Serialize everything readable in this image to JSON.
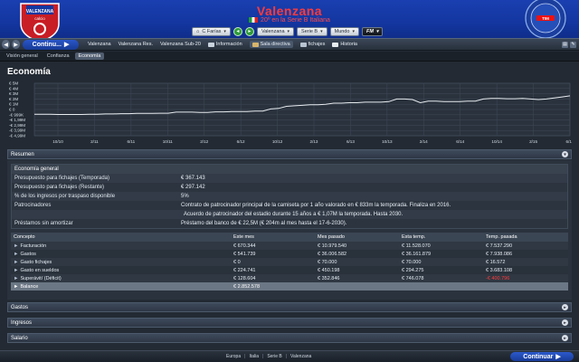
{
  "header": {
    "club_name": "Valenzana",
    "club_subtitle": "20º en la Serie B Italiana",
    "crest_text_1": "VALENZANA",
    "crest_text_2": "calcio",
    "controls": {
      "manager": "C Farías",
      "club": "Valenzana",
      "league": "Serie B",
      "world": "Mundo",
      "fm": "FM"
    }
  },
  "navbar": {
    "continue_label": "Continu...",
    "links": [
      "Valenzana",
      "Valenzana Res.",
      "Valenzana Sub-20",
      "Información",
      "Sala directiva",
      "fichajes",
      "Historia"
    ]
  },
  "subtabs": [
    "Visión general",
    "Confianza",
    "Economía"
  ],
  "page_title": "Economía",
  "chart_data": {
    "type": "line",
    "ylabels": [
      "€ 5M",
      "€ 4M",
      "€ 3M",
      "€ 2M",
      "€ 1M",
      "€ 0",
      "-€ 999K",
      "-€ 1,99M",
      "-€ 2,99M",
      "-€ 3,99M",
      "-€ 4,99M"
    ],
    "yvalues": [
      5,
      4,
      3,
      2,
      1,
      0,
      -1,
      -2,
      -3,
      -4,
      -5
    ],
    "xlabels": [
      "10/10",
      "2/11",
      "6/11",
      "10/11",
      "2/12",
      "6/12",
      "10/12",
      "2/13",
      "6/13",
      "10/13",
      "2/14",
      "6/14",
      "10/14",
      "2/15",
      "6/15"
    ],
    "ylim": [
      -5,
      5
    ],
    "series": [
      {
        "values": [
          -0.9,
          -0.9,
          -0.9,
          -0.95,
          -0.95,
          -0.95,
          -0.95,
          -0.9,
          -0.9,
          -0.85,
          -0.85,
          -0.8,
          -0.8,
          -0.75,
          -0.75,
          -0.75,
          -0.7,
          -0.7,
          -0.5,
          -0.5,
          -0.5,
          -0.55,
          -0.55,
          -0.45,
          -0.45,
          -0.4,
          -0.4,
          -0.4,
          -0.3,
          -0.3,
          0.1,
          0.2,
          0.6,
          0.7,
          0.8,
          0.9,
          0.9,
          1.0,
          1.2,
          1.2,
          1.3,
          1.3,
          1.4,
          1.4,
          1.4,
          1.5,
          2.0,
          2.0,
          1.9,
          1.3,
          1.6,
          1.6,
          1.5,
          1.5,
          1.5,
          1.6,
          1.6,
          2.0,
          2.1,
          2.1,
          2.05,
          2.05,
          2.1,
          2.0,
          1.9,
          2.0,
          2.2,
          2.4,
          2.6
        ]
      }
    ],
    "grid": true,
    "line_color": "#e8ecf0"
  },
  "resumen": {
    "header": "Resumen",
    "general_title": "Economía general",
    "general_rows": [
      {
        "label": "Presupuesto para fichajes (Temporada)",
        "value": "€ 367.143"
      },
      {
        "label": "Presupuesto para fichajes (Restante)",
        "value": "€ 297.142"
      },
      {
        "label": "% de los ingresos por traspaso disponible",
        "value": "5%"
      },
      {
        "label": "Patrocinadores",
        "value": "Contrato de patrocinador principal de la camiseta por 1 año valorado en € 833m la temporada. Finaliza en 2016."
      },
      {
        "label": "",
        "value": "Acuerdo de patrocinador del estadio durante 15 años a € 1,07M la temporada. Hasta 2030."
      },
      {
        "label": "Préstamos sin amortizar",
        "value": "Préstamo del banco de € 22,5M (€ 204m al mes hasta el 17-6-2030)."
      }
    ],
    "table_headers": [
      "Concepto",
      "Este mes",
      "Mes pasado",
      "Esta temp.",
      "Temp. pasada"
    ],
    "table_rows": [
      {
        "concept": "Facturación",
        "este_mes": "€ 670.344",
        "mes_pasado": "€ 10.979.540",
        "esta_temp": "€ 11.528.070",
        "temp_pasada": "€ 7.537.290"
      },
      {
        "concept": "Gastos",
        "este_mes": "€ 541.739",
        "mes_pasado": "€ 36.006.582",
        "esta_temp": "€ 36.161.879",
        "temp_pasada": "€ 7.938.086"
      },
      {
        "concept": "Gasto fichajes",
        "este_mes": "€ 0",
        "mes_pasado": "€ 70.000",
        "esta_temp": "€ 70.000",
        "temp_pasada": "€ 16.572"
      },
      {
        "concept": "Gasto en sueldos",
        "este_mes": "€ 224.741",
        "mes_pasado": "€ 450.198",
        "esta_temp": "€ 294.275",
        "temp_pasada": "€ 3.683.108"
      },
      {
        "concept": "Superávit/ (Déficit)",
        "este_mes": "€ 128.604",
        "mes_pasado": "€ 352.846",
        "esta_temp": "€ 746.078",
        "temp_pasada": "-€ 400.796"
      }
    ],
    "balance_label": "Balance",
    "balance_value": "€ 2.852.578"
  },
  "panels": [
    "Gastos",
    "Ingresos",
    "Salario"
  ],
  "breadcrumb": [
    "Europa",
    "Italia",
    "Serie B",
    "Valenzana"
  ],
  "continue_bottom": "Continuar",
  "colors": {
    "header_blue": "#1336a0",
    "title_red": "#ff3a3a",
    "negative": "#ff3b3b"
  }
}
